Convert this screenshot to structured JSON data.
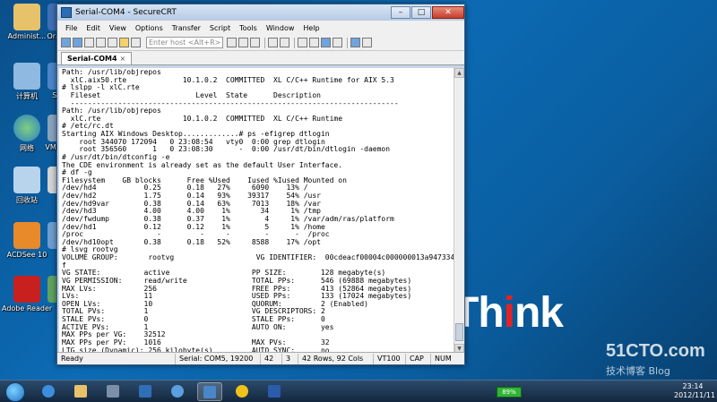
{
  "desktop": {
    "icons_left": [
      "Administ...",
      "计算机",
      "网络",
      "回收站",
      "ACDSee 10",
      "Adobe Reader 9"
    ],
    "icons_col2": [
      "Ora Virt",
      "Secu",
      "VM Work",
      "Ti",
      "",
      "Pu"
    ],
    "brand": {
      "prefix": "Th",
      "highlight": "i",
      "suffix": "nk"
    },
    "watermark": {
      "site": "51CTO.com",
      "sub": "技术博客 Blog"
    }
  },
  "window": {
    "title": "Serial-COM4 - SecureCRT",
    "controls": {
      "minimize": "–",
      "maximize": "□",
      "close": "✕"
    },
    "menu": [
      "File",
      "Edit",
      "View",
      "Options",
      "Transfer",
      "Script",
      "Tools",
      "Window",
      "Help"
    ],
    "toolbar": {
      "host_placeholder": "Enter host <Alt+R>"
    },
    "tab": {
      "label": "Serial-COM4",
      "close": "×"
    },
    "terminal_lines": [
      "Path: /usr/lib/objrepos",
      "  xlC.aix50.rte             10.1.0.2  COMMITTED  XL C/C++ Runtime for AIX 5.3",
      "# lslpp -l xlC.rte",
      "  Fileset                      Level  State      Description",
      "  ----------------------------------------------------------------------------",
      "Path: /usr/lib/objrepos",
      "  xlC.rte                   10.1.0.2  COMMITTED  XL C/C++ Runtime",
      "# /etc/rc.dt",
      "Starting AIX Windows Desktop.............# ps -efigrep dtlogin",
      "    root 344070 172094   0 23:08:54   vty0  0:00 grep dtlogin",
      "    root 356560      1   0 23:08:30      -  0:00 /usr/dt/bin/dtlogin -daemon",
      "# /usr/dt/bin/dtconfig -e",
      "The CDE environment is already set as the default User Interface.",
      "# df -g",
      "Filesystem    GB blocks      Free %Used    Iused %Iused Mounted on",
      "/dev/hd4           0.25      0.18   27%     6090    13% /",
      "/dev/hd2           1.75      0.14   93%    39317    54% /usr",
      "/dev/hd9var        0.38      0.14   63%     7013    18% /var",
      "/dev/hd3           4.00      4.00    1%       34     1% /tmp",
      "/dev/fwdump        0.38      0.37    1%        4     1% /var/adm/ras/platform",
      "/dev/hd1           0.12      0.12    1%        5     1% /home",
      "/proc                 -         -     -        -      -  /proc",
      "/dev/hd10opt       0.38      0.18   52%     8588    17% /opt",
      "# lsvg rootvg",
      "VOLUME GROUP:       rootvg                   VG IDENTIFIER:  00cdeacf00004c000000013a9473348",
      "f",
      "VG STATE:          active                   PP SIZE:        128 megabyte(s)",
      "VG PERMISSION:     read/write               TOTAL PPs:      546 (69888 megabytes)",
      "MAX LVs:           256                      FREE PPs:       413 (52864 megabytes)",
      "LVs:               11                       USED PPs:       133 (17024 megabytes)",
      "OPEN LVs:          10                       QUORUM:         2 (Enabled)",
      "TOTAL PVs:         1                        VG DESCRIPTORS: 2",
      "STALE PVs:         0                        STALE PPs:      0",
      "ACTIVE PVs:        1                        AUTO ON:        yes",
      "MAX PPs per VG:    32512",
      "MAX PPs per PV:    1016                     MAX PVs:        32",
      "LTG size (Dynamic): 256 kilobyte(s)         AUTO SYNC:      no",
      "HOT SPARE:         no                       BB POLICY:      relocatable",
      "# lsps -a",
      "Page Space      Physical Volume   Volume Group    Size %Used Active  Auto  Type",
      "hd6             hdisk0            rootvg        8320MB     1   yes   yes    lv",
      "# "
    ],
    "status": {
      "ready": "Ready",
      "connection": "Serial: COM5, 19200",
      "row": "42",
      "col": "3",
      "size": "42 Rows, 92 Cols",
      "emulation": "VT100",
      "caps": "CAP",
      "num": "NUM"
    }
  },
  "taskbar": {
    "battery": "89%",
    "time": "23:14",
    "date": "2012/11/11"
  }
}
